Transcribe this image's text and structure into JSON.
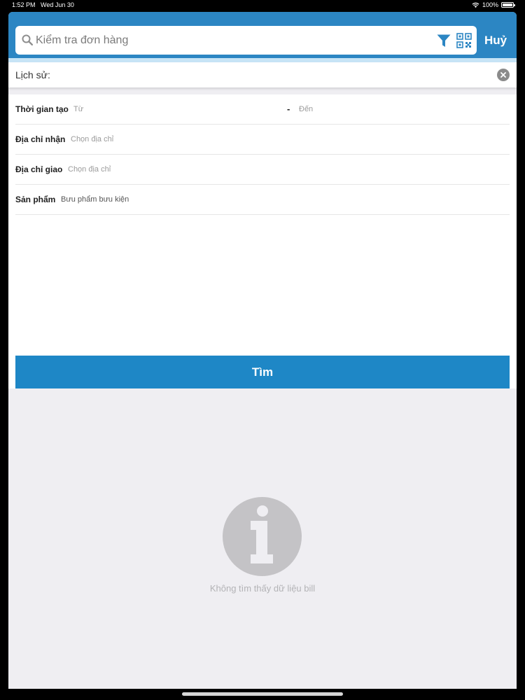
{
  "status_bar": {
    "time": "1:52 PM",
    "date": "Wed Jun 30",
    "battery": "100%"
  },
  "header": {
    "search_placeholder": "Kiểm tra đơn hàng",
    "cancel_label": "Huỷ",
    "icons": {
      "search": "search-icon",
      "filter": "filter-icon",
      "qr": "qr-code-icon"
    }
  },
  "history": {
    "label": "Lịch sử:",
    "clear_icon": "close-circle-icon"
  },
  "form": {
    "created_time": {
      "label": "Thời gian tạo",
      "from_placeholder": "Từ",
      "separator": "-",
      "to_placeholder": "Đến"
    },
    "receive_address": {
      "label": "Địa chỉ nhận",
      "placeholder": "Chọn địa chỉ"
    },
    "delivery_address": {
      "label": "Địa chỉ giao",
      "placeholder": "Chọn địa chỉ"
    },
    "product": {
      "label": "Sản phẩm",
      "value": "Bưu phẩm bưu kiện"
    },
    "submit_label": "Tìm"
  },
  "empty_state": {
    "icon": "info-icon",
    "message": "Không tìm thấy dữ liệu bill"
  },
  "colors": {
    "header": "#2c86c3",
    "button": "#1e87c6",
    "background": "#efeef2"
  }
}
